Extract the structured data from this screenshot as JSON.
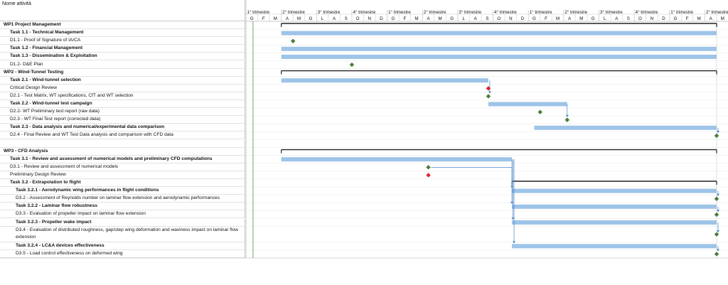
{
  "header": {
    "name_column": "Nome attività",
    "quarters": [
      "1° trimestre",
      "2° trimestre",
      "3° trimestre",
      "4° trimestre",
      "1° trimestre",
      "2° trimestre",
      "3° trimestre",
      "4° trimestre",
      "1° trimestre",
      "2° trimestre",
      "3° trimestre",
      "4° trimestre",
      "1° trimestre",
      "2° trimestre"
    ],
    "months": [
      "G",
      "F",
      "M",
      "A",
      "M",
      "G",
      "L",
      "A",
      "S",
      "O",
      "N",
      "D",
      "G",
      "F",
      "M",
      "A",
      "M",
      "G",
      "L",
      "A",
      "S",
      "O",
      "N",
      "D",
      "G",
      "F",
      "M",
      "A",
      "M",
      "G",
      "L",
      "A",
      "S",
      "O",
      "N",
      "D",
      "G",
      "F",
      "M",
      "A",
      "M"
    ]
  },
  "tasks": [
    {
      "label": "WP1 Project Management",
      "style": "lvl0"
    },
    {
      "label": "Task 1.1 - Technical Management",
      "style": "lvl1 bold"
    },
    {
      "label": "D1.1 - Proof of Signature of IA/CA",
      "style": "lvl1"
    },
    {
      "label": "Task 1.2 - Financial Management",
      "style": "lvl1 bold"
    },
    {
      "label": "Task 1.3 - Dissemination & Exploitation",
      "style": "lvl1 bold"
    },
    {
      "label": "D1.2- D&E Plan",
      "style": "lvl1"
    },
    {
      "label": "WP2 - Wind-Tunnel Testing",
      "style": "lvl0"
    },
    {
      "label": "Task 2.1 - Wind-tunnel selection",
      "style": "lvl1 bold"
    },
    {
      "label": "Critical Design Review",
      "style": "lvl1"
    },
    {
      "label": "D2.1 - Test Matrix, WT specifications, CfT and WT selection",
      "style": "lvl1"
    },
    {
      "label": "Task 2.2 - Wind-tunnel test campaign",
      "style": "lvl1 bold"
    },
    {
      "label": "D2.2- WT Preliminary test report (raw data)",
      "style": "lvl1"
    },
    {
      "label": "D2.3 - WT Final Test report (corrected data)",
      "style": "lvl1"
    },
    {
      "label": "Task 2.3 - Data analysis and numerical/experimental data comparison",
      "style": "lvl1 bold"
    },
    {
      "label": "D2.4 - Final Review and WT Test Data analysis and comparison with CFD data",
      "style": "lvl1"
    },
    {
      "label": "",
      "style": "lvl1"
    },
    {
      "label": "WP3 - CFD Analysis",
      "style": "lvl0"
    },
    {
      "label": "Task 3.1 - Review and assessment of numerical models and preliminary CFD computations",
      "style": "lvl1 bold"
    },
    {
      "label": "D3.1 - Review and assessment of numerical models",
      "style": "lvl1"
    },
    {
      "label": "Preliminary Design Review",
      "style": "lvl1"
    },
    {
      "label": "Task 3.2 - Extrapolation to flight",
      "style": "lvl1 bold"
    },
    {
      "label": "Task 3.2.1 - Aerodynamic wing performances in flight conditions",
      "style": "lvl2 bold"
    },
    {
      "label": "D3.2 - Assessment of Reynolds number on laminar flow extension and aerodynamic performances",
      "style": "lvl2"
    },
    {
      "label": "Task 3.2.2 - Laminar flow robustness",
      "style": "lvl2 bold"
    },
    {
      "label": "D3.3 - Evaluation of propeller impact on laminar flow extension",
      "style": "lvl2"
    },
    {
      "label": "Task 3.2.3 - Propeller wake impact",
      "style": "lvl2 bold"
    },
    {
      "label": "D3.4 - Evaluation of distributed roughness, gap/step wing deformation and waviness impact on laminar flow extension",
      "style": "lvl2 tall"
    },
    {
      "label": "Task 3.2.4 - LC&A devices effectiveness",
      "style": "lvl2 bold"
    },
    {
      "label": "D3.5 - Load control effectiveness on deformed wing",
      "style": "lvl2"
    }
  ],
  "colors": {
    "bar": "#9ec4e8",
    "summary": "#222222",
    "milestone": "#4a7c3a",
    "review": "#e0202a",
    "link": "#4a86c8",
    "grid": "#c8c8c8",
    "today": "#3a9a3a"
  },
  "schedule": {
    "bars": [
      {
        "row": 1,
        "start": 3.0,
        "end": 40.0
      },
      {
        "row": 3,
        "start": 3.0,
        "end": 40.0
      },
      {
        "row": 4,
        "start": 3.0,
        "end": 40.0
      },
      {
        "row": 7,
        "start": 3.0,
        "end": 20.6
      },
      {
        "row": 10,
        "start": 20.6,
        "end": 27.3
      },
      {
        "row": 13,
        "start": 24.5,
        "end": 40.0
      },
      {
        "row": 17,
        "start": 3.0,
        "end": 22.6
      },
      {
        "row": 21,
        "start": 22.6,
        "end": 40.0
      },
      {
        "row": 23,
        "start": 22.6,
        "end": 40.0
      },
      {
        "row": 25,
        "start": 22.6,
        "end": 40.0
      },
      {
        "row": 27,
        "start": 22.6,
        "end": 40.0
      }
    ],
    "summaries": [
      {
        "row": 0,
        "start": 3.0,
        "end": 40.0
      },
      {
        "row": 6,
        "start": 3.0,
        "end": 40.0
      },
      {
        "row": 16,
        "start": 3.0,
        "end": 40.0
      },
      {
        "row": 20,
        "start": 22.6,
        "end": 40.0
      }
    ],
    "milestones": [
      {
        "row": 2,
        "at": 4.0,
        "kind": "deliverable"
      },
      {
        "row": 5,
        "at": 9.0,
        "kind": "deliverable"
      },
      {
        "row": 8,
        "at": 20.6,
        "kind": "review"
      },
      {
        "row": 9,
        "at": 20.6,
        "kind": "deliverable"
      },
      {
        "row": 11,
        "at": 25.0,
        "kind": "deliverable"
      },
      {
        "row": 12,
        "at": 27.3,
        "kind": "deliverable"
      },
      {
        "row": 14,
        "at": 40.0,
        "kind": "deliverable"
      },
      {
        "row": 18,
        "at": 15.5,
        "kind": "deliverable"
      },
      {
        "row": 19,
        "at": 15.5,
        "kind": "review"
      },
      {
        "row": 22,
        "at": 40.0,
        "kind": "deliverable"
      },
      {
        "row": 24,
        "at": 40.0,
        "kind": "deliverable"
      },
      {
        "row": 26,
        "at": 40.0,
        "kind": "deliverable"
      },
      {
        "row": 28,
        "at": 40.0,
        "kind": "deliverable"
      }
    ]
  }
}
